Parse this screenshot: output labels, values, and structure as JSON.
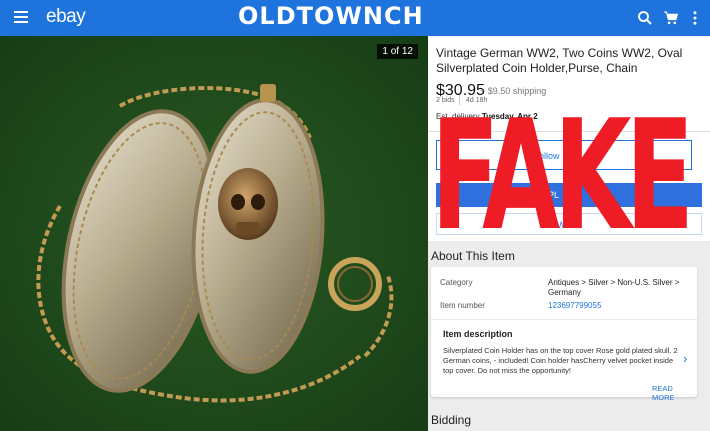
{
  "header": {
    "logo": "ebay",
    "watermark": "OLDTOWNCH",
    "icons": [
      "menu-icon",
      "search-icon",
      "cart-icon",
      "more-vert-icon"
    ]
  },
  "gallery": {
    "counter": "1 of 12"
  },
  "listing": {
    "title": "Vintage German WW2, Two Coins WW2, Oval Silverplated Coin Holder,Purse, Chain",
    "price": "$30.95",
    "shipping": "+ $9.50 shipping",
    "bids": "2 bids",
    "time_left": "4d 18h",
    "delivery_label": "Est. delivery",
    "delivery_date": "Tuesday, Apr 2"
  },
  "actions": {
    "watch_label": "ollow",
    "bid_label": "PL",
    "offer_label": "W"
  },
  "overlay": {
    "stamp": "FAKE",
    "stamp_color": "#ee1c24"
  },
  "about": {
    "title": "About This Item",
    "category_label": "Category",
    "category_value": "Antiques > Silver > Non-U.S. Silver > Germany",
    "item_number_label": "Item number",
    "item_number_value": "123697799055",
    "description_title": "Item description",
    "description_text": "Silverplated Coin Holder has on the top cover Rose gold plated skull. 2 German coins, - included! Coin holder hasCherry velvet pocket inside top cover. Do not miss the opportunity!",
    "read_more": "READ MORE"
  },
  "bidding": {
    "title": "Bidding"
  },
  "colors": {
    "header": "#1e73dc",
    "accent": "#1e73dc",
    "felt": "#1f4a1c"
  }
}
